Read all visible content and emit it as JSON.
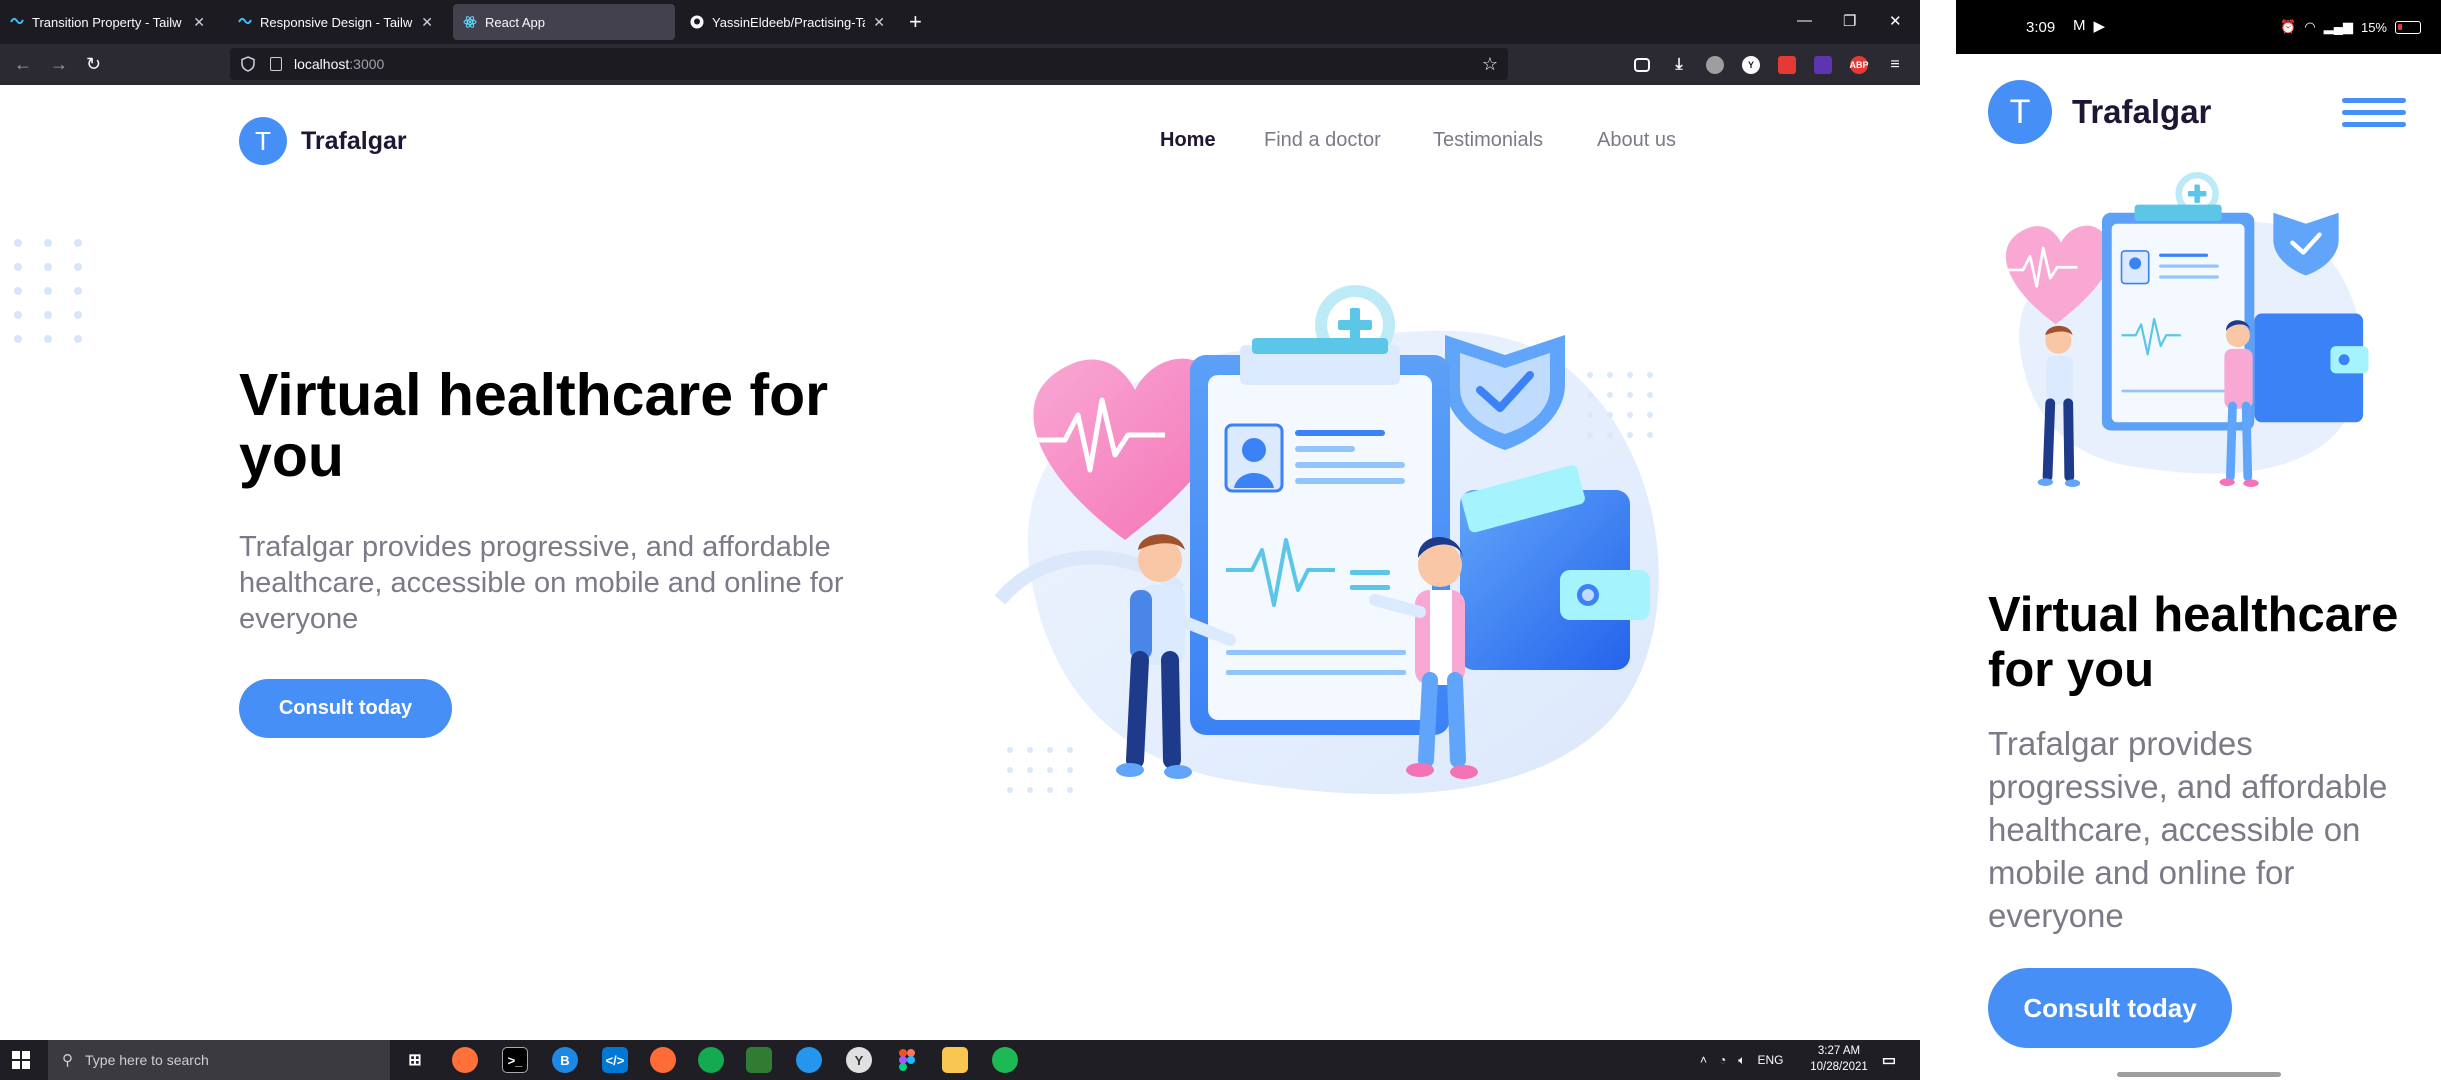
{
  "browser": {
    "tabs": [
      {
        "title": "Transition Property - Tailwind CSS",
        "icon": "tailwind-icon",
        "active": false
      },
      {
        "title": "Responsive Design - Tailwind CSS",
        "icon": "tailwind-icon",
        "active": false
      },
      {
        "title": "React App",
        "icon": "react-icon",
        "active": true
      },
      {
        "title": "YassinEldeeb/Practising-Tailwind",
        "icon": "github-icon",
        "active": false
      }
    ],
    "new_tab": "+",
    "url_host": "localhost",
    "url_port": ":3000",
    "window_controls": {
      "minimize": "—",
      "restore": "❐",
      "close": "✕"
    }
  },
  "site": {
    "brand_initial": "T",
    "brand_name": "Trafalgar",
    "nav": [
      "Home",
      "Find a doctor",
      "Testimonials",
      "About us"
    ],
    "hero_title": "Virtual healthcare for you",
    "hero_subtitle": "Trafalgar provides progressive, and affordable healthcare, accessible on mobile and online for everyone",
    "cta": "Consult today",
    "accent_color": "#458ff6"
  },
  "taskbar": {
    "search_placeholder": "Type here to search",
    "language": "ENG",
    "time": "3:27 AM",
    "date": "10/28/2021"
  },
  "phone": {
    "time": "3:09",
    "battery": "15%",
    "brand_initial": "T",
    "brand_name": "Trafalgar",
    "hero_title": "Virtual healthcare for you",
    "hero_subtitle": "Trafalgar provides progressive, and affordable healthcare, accessible on mobile and online for everyone",
    "cta": "Consult today"
  }
}
